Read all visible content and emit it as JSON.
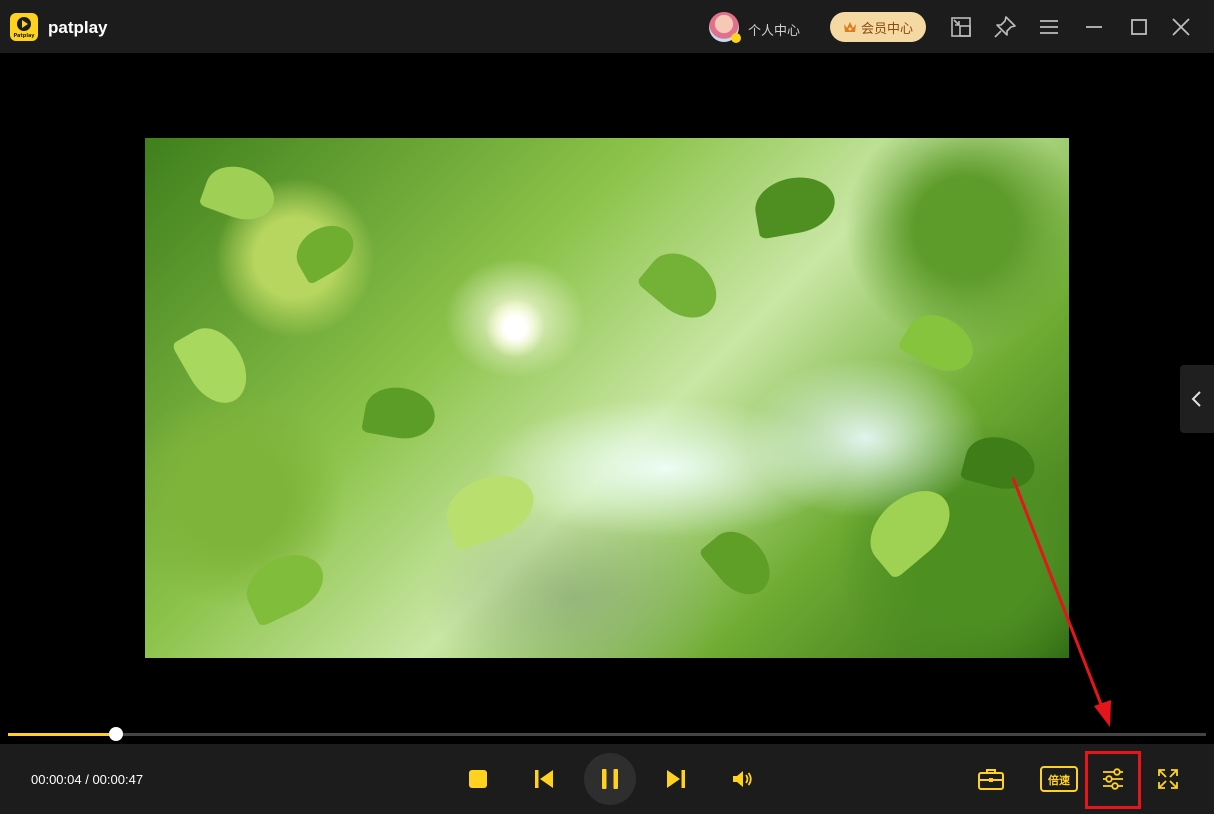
{
  "app": {
    "name": "patplay",
    "logo_text": "Patplay"
  },
  "header": {
    "personal_center_label": "个人中心",
    "vip_center_label": "会员中心",
    "icons": [
      "avatar",
      "crown-icon",
      "mini-mode-icon",
      "pin-icon",
      "menu-icon",
      "minimize-icon",
      "maximize-icon",
      "close-icon"
    ]
  },
  "player": {
    "current_time": "00:00:04",
    "separator": " / ",
    "total_time": "00:00:47",
    "progress_fraction": 0.09,
    "speed_label": "倍速",
    "accent_color": "#ffd21f",
    "controls": [
      "stop-icon",
      "previous-icon",
      "pause-icon",
      "next-icon",
      "volume-icon",
      "toolbox-icon",
      "speed-button",
      "settings-icon",
      "fullscreen-icon"
    ]
  },
  "annotation": {
    "color": "#e8141c",
    "target": "settings-button"
  }
}
